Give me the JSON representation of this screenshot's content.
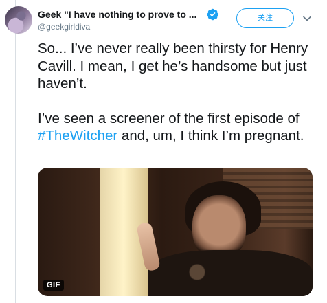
{
  "tweet": {
    "display_name": "Geek \"I have nothing to prove to ...",
    "handle": "@geekgirldiva",
    "follow_label": "关注",
    "verified_icon": "verified-badge-icon",
    "more_icon": "chevron-down-icon",
    "paragraph1": "So... I’ve never really been thirsty for Henry Cavill. I mean, I get he’s handsome but just haven’t.",
    "paragraph2_before": "I’ve seen a screener of the first episode of ",
    "hashtag": "#TheWitcher",
    "paragraph2_after": " and, um, I think I’m pregnant.",
    "media_badge": "GIF",
    "accent_color": "#1da1f2"
  }
}
